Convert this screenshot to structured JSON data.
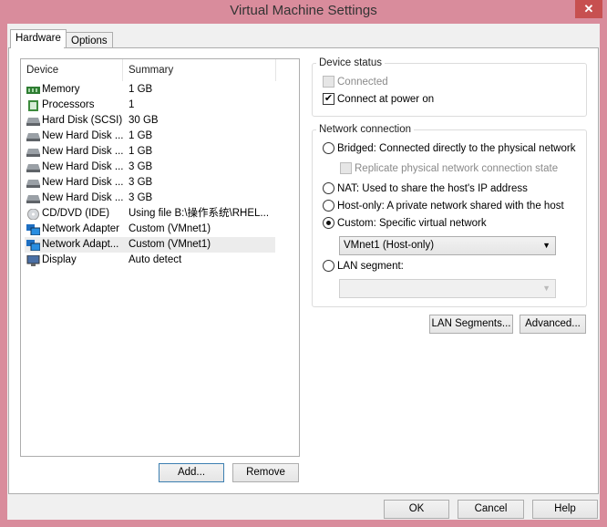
{
  "window": {
    "title": "Virtual Machine Settings",
    "close": "✕"
  },
  "tabs": [
    {
      "label": "Hardware",
      "active": true
    },
    {
      "label": "Options",
      "active": false
    }
  ],
  "device_list": {
    "columns": [
      "Device",
      "Summary"
    ],
    "rows": [
      {
        "device": "Memory",
        "summary": "1 GB",
        "icon": "memory-icon"
      },
      {
        "device": "Processors",
        "summary": "1",
        "icon": "processor-icon"
      },
      {
        "device": "Hard Disk (SCSI)",
        "summary": "30 GB",
        "icon": "hard-disk-icon"
      },
      {
        "device": "New Hard Disk ...",
        "summary": "1 GB",
        "icon": "hard-disk-icon"
      },
      {
        "device": "New Hard Disk ...",
        "summary": "1 GB",
        "icon": "hard-disk-icon"
      },
      {
        "device": "New Hard Disk ...",
        "summary": "3 GB",
        "icon": "hard-disk-icon"
      },
      {
        "device": "New Hard Disk ...",
        "summary": "3 GB",
        "icon": "hard-disk-icon"
      },
      {
        "device": "New Hard Disk ...",
        "summary": "3 GB",
        "icon": "hard-disk-icon"
      },
      {
        "device": "CD/DVD (IDE)",
        "summary": "Using file B:\\操作系统\\RHEL...",
        "icon": "cd-dvd-icon"
      },
      {
        "device": "Network Adapter",
        "summary": "Custom (VMnet1)",
        "icon": "network-adapter-icon"
      },
      {
        "device": "Network Adapt...",
        "summary": "Custom (VMnet1)",
        "icon": "network-adapter-icon",
        "selected": true
      },
      {
        "device": "Display",
        "summary": "Auto detect",
        "icon": "display-icon"
      }
    ],
    "add": "Add...",
    "remove": "Remove"
  },
  "device_status": {
    "legend": "Device status",
    "connected": "Connected",
    "connected_checked": false,
    "power_on": "Connect at power on",
    "power_on_checked": true
  },
  "network": {
    "legend": "Network connection",
    "bridged": "Bridged: Connected directly to the physical network",
    "replicate": "Replicate physical network connection state",
    "nat": "NAT: Used to share the host's IP address",
    "hostonly": "Host-only: A private network shared with the host",
    "custom": "Custom: Specific virtual network",
    "selected": "custom",
    "custom_value": "VMnet1 (Host-only)",
    "lan": "LAN segment:",
    "lan_value": ""
  },
  "buttons": {
    "lan_segments": "LAN Segments...",
    "advanced": "Advanced...",
    "ok": "OK",
    "cancel": "Cancel",
    "help": "Help"
  }
}
